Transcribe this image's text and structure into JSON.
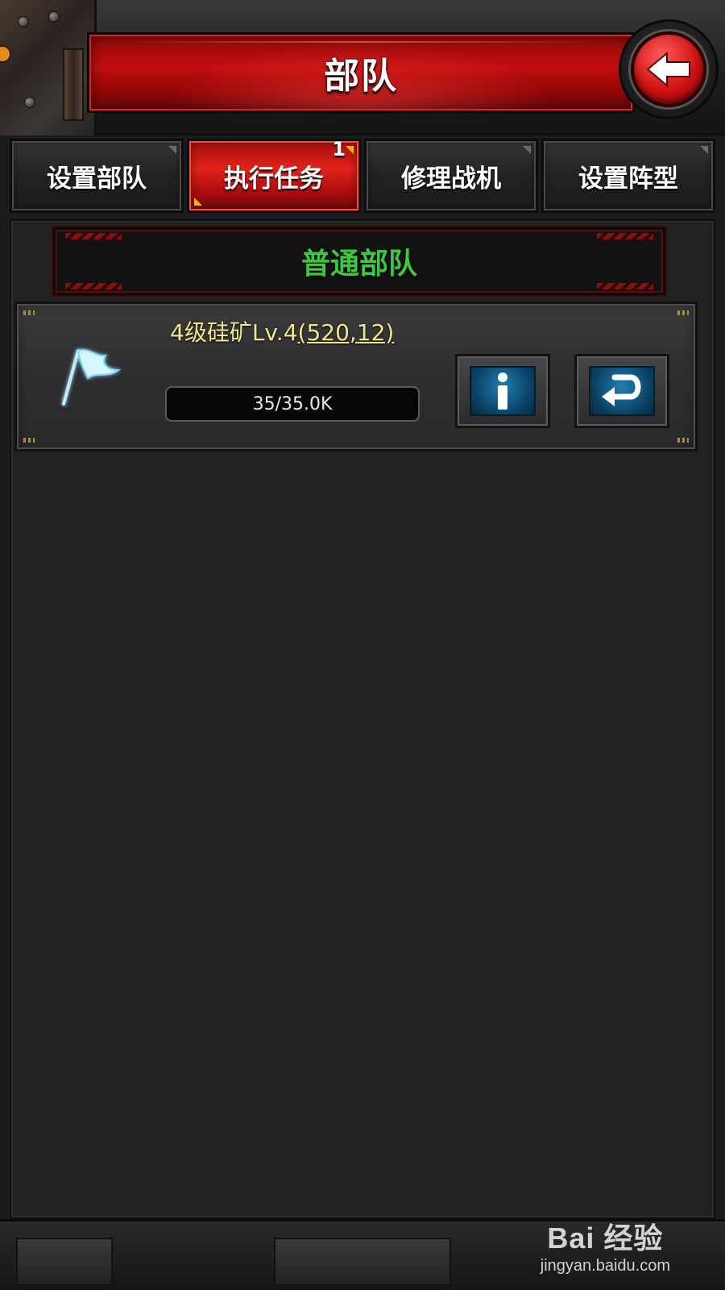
{
  "header": {
    "title": "部队",
    "back_icon": "back-arrow-icon"
  },
  "tabs": [
    {
      "label": "设置部队",
      "active": false
    },
    {
      "label": "执行任务",
      "active": true,
      "badge": "1"
    },
    {
      "label": "修理战机",
      "active": false
    },
    {
      "label": "设置阵型",
      "active": false
    }
  ],
  "section": {
    "title": "普通部队"
  },
  "task": {
    "icon": "flag-icon",
    "name": "4级硅矿Lv.4",
    "coords": "(520,12)",
    "progress_text": "35/35.0K",
    "progress_fraction": 0.001,
    "info_icon": "info-icon",
    "return_icon": "return-icon"
  },
  "watermark": {
    "logo": "Bai 经验",
    "url": "jingyan.baidu.com"
  },
  "colors": {
    "accent_red": "#c40f0f",
    "section_green": "#3fc83f",
    "task_yellow": "#f0e68c",
    "icon_blue": "#1f7fb0"
  }
}
